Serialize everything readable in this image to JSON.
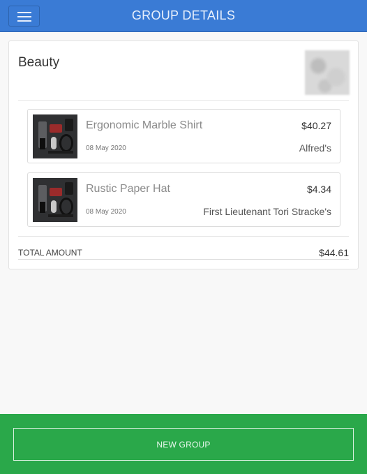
{
  "header": {
    "title": "GROUP DETAILS",
    "menu_icon": "hamburger-icon",
    "background_color": "#3a7bd5"
  },
  "group": {
    "name": "Beauty",
    "items": [
      {
        "name": "Ergonomic Marble Shirt",
        "price": "$40.27",
        "date": "08 May 2020",
        "vendor": "Alfred's"
      },
      {
        "name": "Rustic Paper Hat",
        "price": "$4.34",
        "date": "08 May 2020",
        "vendor": "First Lieutenant Tori Stracke's"
      }
    ],
    "total_label": "TOTAL AMOUNT",
    "total_amount": "$44.61"
  },
  "footer": {
    "new_group_label": "NEW GROUP",
    "background_color": "#2aa84a"
  }
}
